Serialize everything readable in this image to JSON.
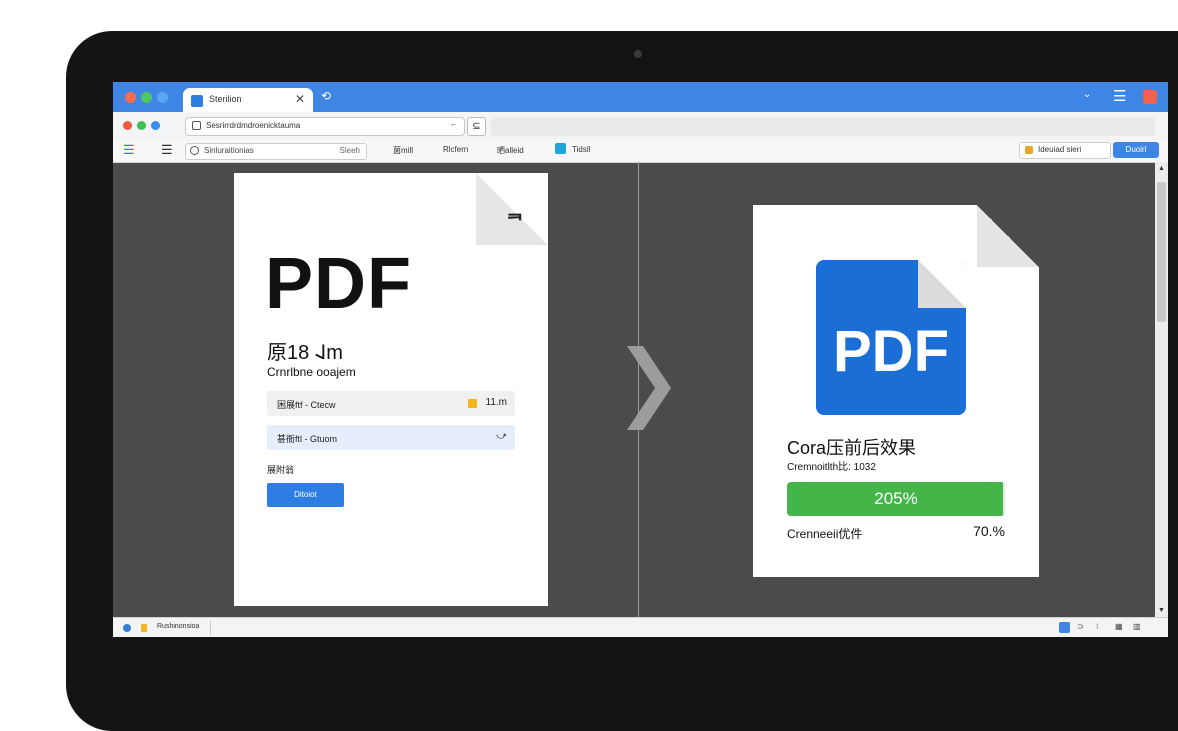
{
  "browser": {
    "tab_title": "Sterilion",
    "tab_close": "✕",
    "new_tab": "⟲",
    "titlebar_right": [
      "⌄",
      "☰"
    ],
    "url": "Sesrirrdrdmdroenicktauma",
    "url_option": "⌐",
    "address_button": "⊆",
    "toolbar": {
      "search_label": "Sinluraitionias",
      "search_hint": "Sleeh",
      "items": [
        "菌mill",
        "Rlcfern",
        "晒alleid",
        "Tidsll"
      ],
      "right_field": "Ideuiad sieri",
      "button": "Duoirl"
    }
  },
  "left_doc": {
    "corner_icon": "ᆿ",
    "pdf_label": "PDF",
    "title": "原18 𐐈m",
    "subtitle": "Crnrlbne ooajem",
    "row1_label": "困展ftf ‐ Ctecw",
    "row1_value": "11.m",
    "row2_label": "甚衙ftl ‐ Gtuom",
    "row2_value": "⤻",
    "small_label": "展附翁",
    "button": "Ditoiot"
  },
  "right_doc": {
    "pdf_label": "PDF",
    "title": "Cora压前后效果",
    "subtitle": "Cremnoitlth比: 1032",
    "progress_label": "205%",
    "progress_value": 0.99,
    "footer_left": "Crenneeii优件",
    "footer_right": "70.%"
  },
  "status": {
    "text": "Rushinonsioa",
    "right_icons": [
      "⊃",
      "⁝",
      "▦",
      "▥"
    ]
  },
  "colors": {
    "accent": "#3f86e4",
    "pdf_blue": "#1b6ed6",
    "progress": "#44b649",
    "highlight": "#f2b51c"
  }
}
